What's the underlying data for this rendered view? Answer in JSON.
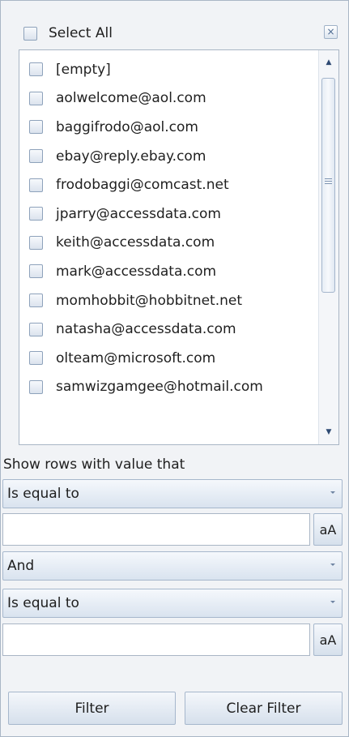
{
  "header": {
    "select_all_label": "Select All",
    "close_glyph": "×"
  },
  "list": {
    "items": [
      {
        "label": "[empty]",
        "checked": false
      },
      {
        "label": "aolwelcome@aol.com",
        "checked": false
      },
      {
        "label": "baggifrodo@aol.com",
        "checked": false
      },
      {
        "label": "ebay@reply.ebay.com",
        "checked": false
      },
      {
        "label": "frodobaggi@comcast.net",
        "checked": false
      },
      {
        "label": "jparry@accessdata.com",
        "checked": false
      },
      {
        "label": "keith@accessdata.com",
        "checked": false
      },
      {
        "label": "mark@accessdata.com",
        "checked": false
      },
      {
        "label": "momhobbit@hobbitnet.net",
        "checked": false
      },
      {
        "label": "natasha@accessdata.com",
        "checked": false
      },
      {
        "label": "olteam@microsoft.com",
        "checked": false
      },
      {
        "label": "samwizgamgee@hotmail.com",
        "checked": false
      }
    ],
    "scroll_up_glyph": "▲",
    "scroll_down_glyph": "▼"
  },
  "filter": {
    "section_label": "Show rows with value that",
    "condition1": {
      "operator": "Is equal to",
      "value": "",
      "case_label": "aA"
    },
    "join_operator": "And",
    "condition2": {
      "operator": "Is equal to",
      "value": "",
      "case_label": "aA"
    }
  },
  "buttons": {
    "filter_label": "Filter",
    "clear_label": "Clear Filter"
  },
  "colors": {
    "panel_bg": "#f1f3f6",
    "border": "#a9b6c5",
    "button_gradient_top": "#f4f7fb",
    "button_gradient_bottom": "#d6e0ec"
  }
}
